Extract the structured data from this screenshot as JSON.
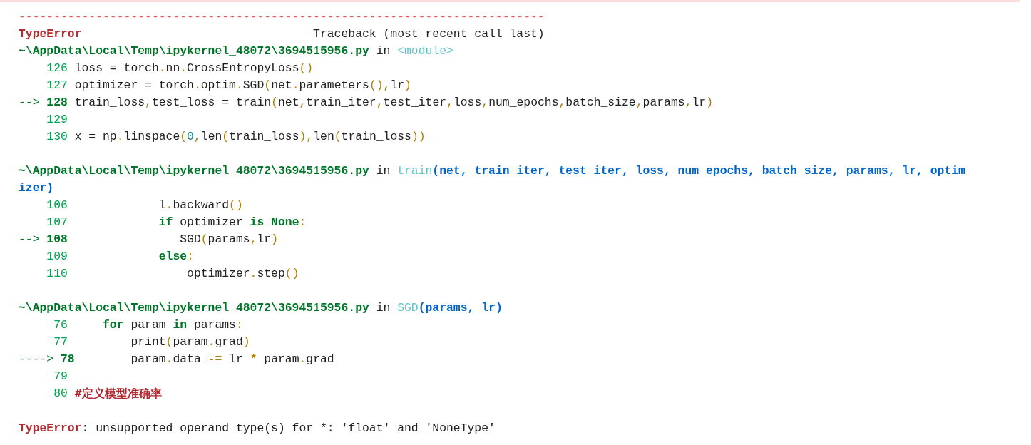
{
  "separator": "---------------------------------------------------------------------------",
  "header": {
    "error_name": "TypeError",
    "traceback_label": "Traceback (most recent call last)"
  },
  "frames": [
    {
      "file": "~\\AppData\\Local\\Temp\\ipykernel_48072\\3694515956.py",
      "in": "in",
      "func": "<module>",
      "lines": [
        {
          "number": "126",
          "current": false,
          "tokens": [
            {
              "kind": "text",
              "text": "loss = torch"
            },
            {
              "kind": "punct",
              "text": "."
            },
            {
              "kind": "text",
              "text": "nn"
            },
            {
              "kind": "punct",
              "text": "."
            },
            {
              "kind": "text",
              "text": "CrossEntropyLoss"
            },
            {
              "kind": "punct",
              "text": "()"
            }
          ]
        },
        {
          "number": "127",
          "current": false,
          "tokens": [
            {
              "kind": "text",
              "text": "optimizer = torch"
            },
            {
              "kind": "punct",
              "text": "."
            },
            {
              "kind": "text",
              "text": "optim"
            },
            {
              "kind": "punct",
              "text": "."
            },
            {
              "kind": "text",
              "text": "SGD"
            },
            {
              "kind": "punct",
              "text": "("
            },
            {
              "kind": "text",
              "text": "net"
            },
            {
              "kind": "punct",
              "text": "."
            },
            {
              "kind": "text",
              "text": "parameters"
            },
            {
              "kind": "punct",
              "text": "(),"
            },
            {
              "kind": "text",
              "text": "lr"
            },
            {
              "kind": "punct",
              "text": ")"
            }
          ]
        },
        {
          "number": "128",
          "current": true,
          "arrow": "-->",
          "tokens": [
            {
              "kind": "text",
              "text": "train_loss"
            },
            {
              "kind": "punct",
              "text": ","
            },
            {
              "kind": "text",
              "text": "test_loss = train"
            },
            {
              "kind": "punct",
              "text": "("
            },
            {
              "kind": "text",
              "text": "net"
            },
            {
              "kind": "punct",
              "text": ","
            },
            {
              "kind": "text",
              "text": "train_iter"
            },
            {
              "kind": "punct",
              "text": ","
            },
            {
              "kind": "text",
              "text": "test_iter"
            },
            {
              "kind": "punct",
              "text": ","
            },
            {
              "kind": "text",
              "text": "loss"
            },
            {
              "kind": "punct",
              "text": ","
            },
            {
              "kind": "text",
              "text": "num_epochs"
            },
            {
              "kind": "punct",
              "text": ","
            },
            {
              "kind": "text",
              "text": "batch_size"
            },
            {
              "kind": "punct",
              "text": ","
            },
            {
              "kind": "text",
              "text": "params"
            },
            {
              "kind": "punct",
              "text": ","
            },
            {
              "kind": "text",
              "text": "lr"
            },
            {
              "kind": "punct",
              "text": ")"
            }
          ]
        },
        {
          "number": "129",
          "current": false
        },
        {
          "number": "130",
          "current": false,
          "tokens": [
            {
              "kind": "text",
              "text": "x = np"
            },
            {
              "kind": "punct",
              "text": "."
            },
            {
              "kind": "text",
              "text": "linspace"
            },
            {
              "kind": "punct",
              "text": "("
            },
            {
              "kind": "number",
              "text": "0"
            },
            {
              "kind": "punct",
              "text": ","
            },
            {
              "kind": "text",
              "text": "len"
            },
            {
              "kind": "punct",
              "text": "("
            },
            {
              "kind": "text",
              "text": "train_loss"
            },
            {
              "kind": "punct",
              "text": "),"
            },
            {
              "kind": "text",
              "text": "len"
            },
            {
              "kind": "punct",
              "text": "("
            },
            {
              "kind": "text",
              "text": "train_loss"
            },
            {
              "kind": "punct",
              "text": "))"
            }
          ]
        }
      ]
    },
    {
      "file": "~\\AppData\\Local\\Temp\\ipykernel_48072\\3694515956.py",
      "in": "in",
      "func": "train",
      "args": "(net, train_iter, test_iter, loss, num_epochs, batch_size, params, lr, optimizer)",
      "lines": [
        {
          "number": "106",
          "current": false,
          "tokens": [
            {
              "kind": "text",
              "text": "            l"
            },
            {
              "kind": "punct",
              "text": "."
            },
            {
              "kind": "text",
              "text": "backward"
            },
            {
              "kind": "punct",
              "text": "()"
            }
          ]
        },
        {
          "number": "107",
          "current": false,
          "tokens": [
            {
              "kind": "keyword",
              "text": "            if"
            },
            {
              "kind": "text",
              "text": " optimizer "
            },
            {
              "kind": "keyword",
              "text": "is None"
            },
            {
              "kind": "punct",
              "text": ":"
            }
          ]
        },
        {
          "number": "108",
          "current": true,
          "arrow": "-->",
          "tokens": [
            {
              "kind": "text",
              "text": "               SGD"
            },
            {
              "kind": "punct",
              "text": "("
            },
            {
              "kind": "text",
              "text": "params"
            },
            {
              "kind": "punct",
              "text": ","
            },
            {
              "kind": "text",
              "text": "lr"
            },
            {
              "kind": "punct",
              "text": ")"
            }
          ]
        },
        {
          "number": "109",
          "current": false,
          "tokens": [
            {
              "kind": "keyword",
              "text": "            else"
            },
            {
              "kind": "punct",
              "text": ":"
            }
          ]
        },
        {
          "number": "110",
          "current": false,
          "tokens": [
            {
              "kind": "text",
              "text": "                optimizer"
            },
            {
              "kind": "punct",
              "text": "."
            },
            {
              "kind": "text",
              "text": "step"
            },
            {
              "kind": "punct",
              "text": "()"
            }
          ]
        }
      ]
    },
    {
      "file": "~\\AppData\\Local\\Temp\\ipykernel_48072\\3694515956.py",
      "in": "in",
      "func": "SGD",
      "args": "(params, lr)",
      "lines": [
        {
          "number": "76",
          "current": false,
          "tokens": [
            {
              "kind": "keyword",
              "text": "    for"
            },
            {
              "kind": "text",
              "text": " param "
            },
            {
              "kind": "keyword",
              "text": "in"
            },
            {
              "kind": "text",
              "text": " params"
            },
            {
              "kind": "punct",
              "text": ":"
            }
          ]
        },
        {
          "number": "77",
          "current": false,
          "tokens": [
            {
              "kind": "text",
              "text": "        print"
            },
            {
              "kind": "punct",
              "text": "("
            },
            {
              "kind": "text",
              "text": "param"
            },
            {
              "kind": "punct",
              "text": "."
            },
            {
              "kind": "text",
              "text": "grad"
            },
            {
              "kind": "punct",
              "text": ")"
            }
          ]
        },
        {
          "number": "78",
          "current": true,
          "arrow": "---->",
          "tokens": [
            {
              "kind": "text",
              "text": "        param"
            },
            {
              "kind": "punct",
              "text": "."
            },
            {
              "kind": "text",
              "text": "data "
            },
            {
              "kind": "operator",
              "text": "-="
            },
            {
              "kind": "text",
              "text": " lr "
            },
            {
              "kind": "operator",
              "text": "*"
            },
            {
              "kind": "text",
              "text": " param"
            },
            {
              "kind": "punct",
              "text": "."
            },
            {
              "kind": "text",
              "text": "grad"
            }
          ]
        },
        {
          "number": "79",
          "current": false
        },
        {
          "number": "80",
          "current": false,
          "tokens": [
            {
              "kind": "comment",
              "text": "#定义模型准确率"
            }
          ]
        }
      ]
    }
  ],
  "error": {
    "name": "TypeError",
    "message": ": unsupported operand type(s) for *: 'float' and 'NoneType'"
  }
}
